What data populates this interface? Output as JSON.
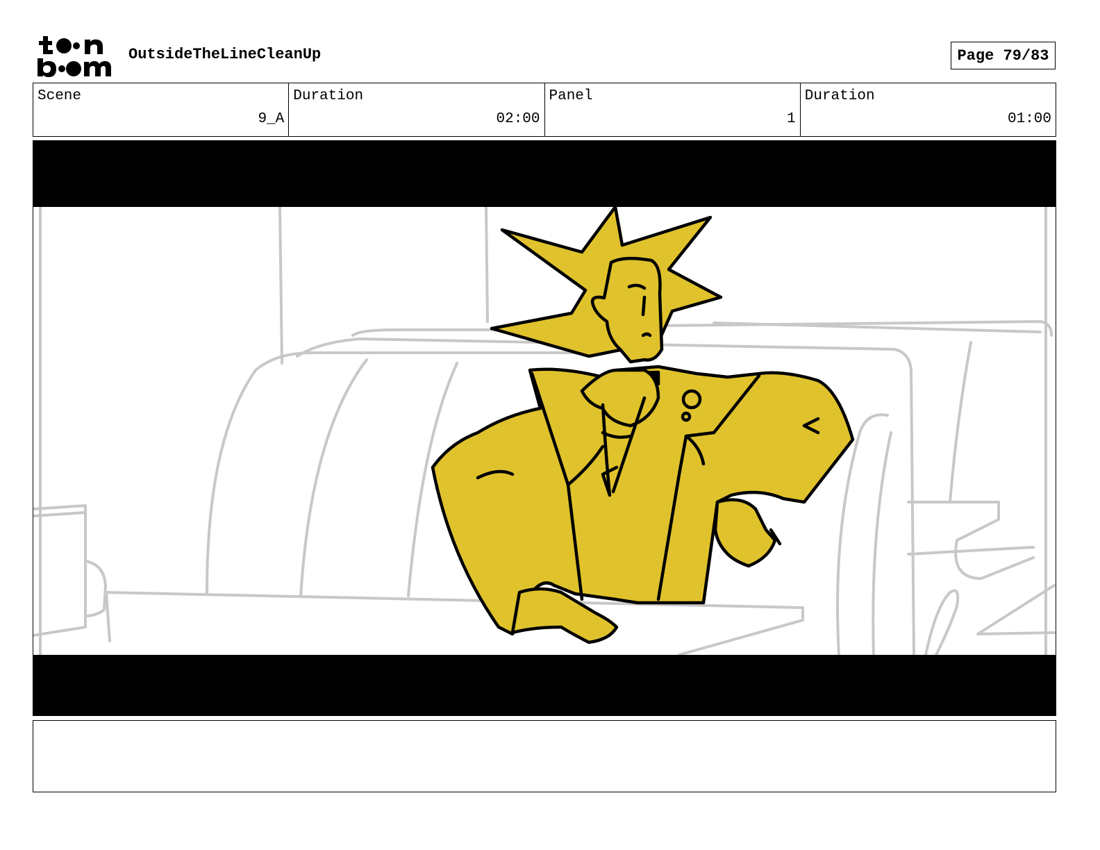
{
  "header": {
    "logo_text_top": "toon",
    "logo_text_bottom": "boom",
    "project_title": "OutsideTheLineCleanUp",
    "page_label": "Page 79/83"
  },
  "info": [
    {
      "label": "Scene",
      "value": "9_A"
    },
    {
      "label": "Duration",
      "value": "02:00"
    },
    {
      "label": "Panel",
      "value": "1"
    },
    {
      "label": "Duration",
      "value": "01:00"
    }
  ],
  "panel": {
    "letterbox_color": "#000000",
    "character_fill": "#E0C22C",
    "background_line_color": "#C8C8C8"
  },
  "notes": ""
}
